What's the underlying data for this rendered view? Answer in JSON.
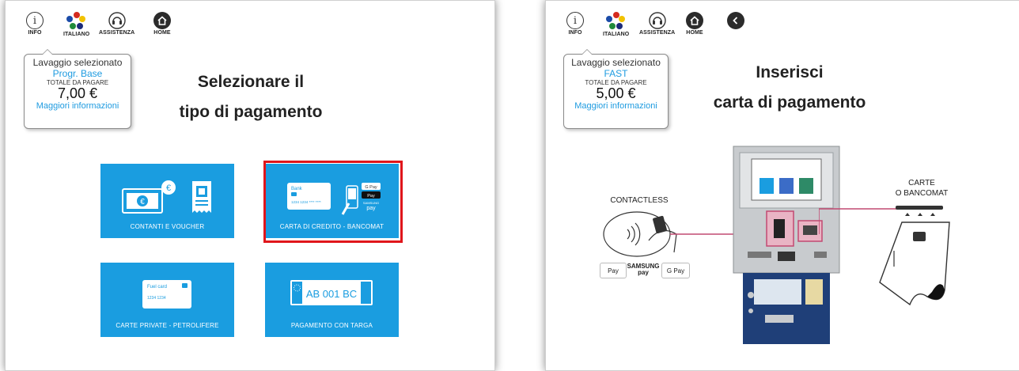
{
  "left": {
    "topbar": {
      "info": "INFO",
      "language": "ITALIANO",
      "assist": "ASSISTENZA",
      "home": "HOME"
    },
    "tooltip": {
      "line1": "Lavaggio selezionato",
      "program": "Progr. Base",
      "total_label": "TOTALE DA PAGARE",
      "amount": "7,00 €",
      "more": "Maggiori informazioni"
    },
    "heading": {
      "line1": "Selezionare il",
      "line2": "tipo di pagamento"
    },
    "tiles": [
      {
        "label": "CONTANTI E VOUCHER"
      },
      {
        "label": "CARTA DI CREDITO - BANCOMAT",
        "selected": true
      },
      {
        "label": "CARTE PRIVATE - PETROLIFERE"
      },
      {
        "label": "PAGAMENTO CON TARGA"
      }
    ],
    "card_art": {
      "bank": "Bank",
      "number": "1234 1234 **** ****",
      "gpay": "G Pay",
      "apay": "Pay",
      "samsung1": "SAMSUNG",
      "samsung2": "pay",
      "fuel": "Fuel card",
      "fuel_number": "1234 1234",
      "plate": "AB 001 BC"
    }
  },
  "right": {
    "topbar": {
      "info": "INFO",
      "language": "ITALIANO",
      "assist": "ASSISTENZA",
      "home": "HOME"
    },
    "tooltip": {
      "line1": "Lavaggio selezionato",
      "program": "FAST",
      "total_label": "TOTALE DA PAGARE",
      "amount": "5,00 €",
      "more": "Maggiori informazioni"
    },
    "heading": {
      "line1": "Inserisci",
      "line2": "carta di pagamento"
    },
    "illustration": {
      "contactless": "CONTACTLESS",
      "carte1": "CARTE",
      "carte2": "O BANCOMAT",
      "badges": [
        "Pay",
        "SAMSUNG pay",
        "G Pay"
      ]
    }
  },
  "colors": {
    "tile_blue": "#1a9de0",
    "selection_red": "#e0161b",
    "link_blue": "#1e9be0",
    "kiosk_navy": "#1f3f78"
  }
}
